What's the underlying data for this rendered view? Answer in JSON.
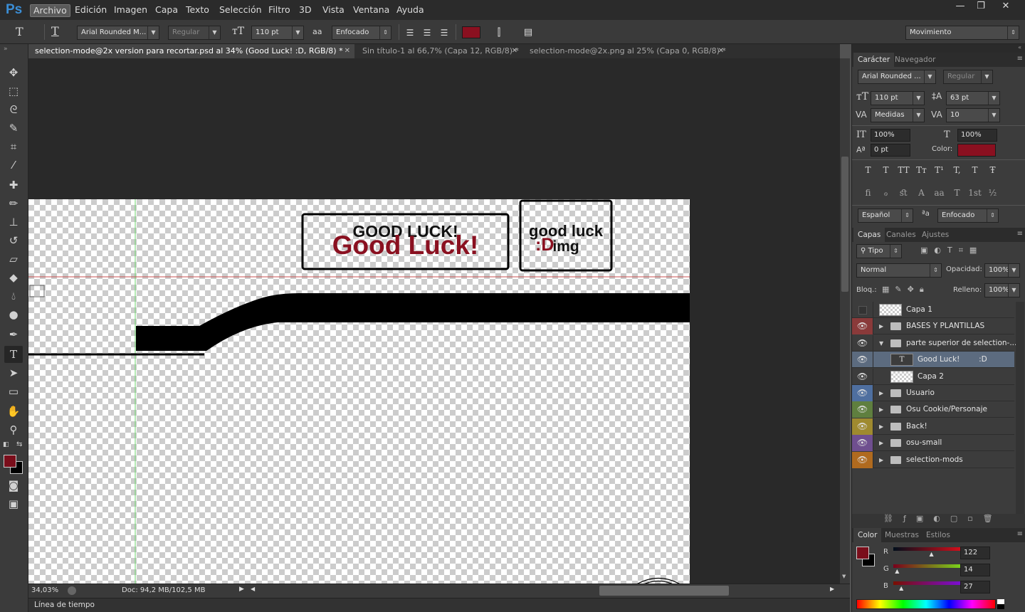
{
  "app": {
    "logo": "Ps"
  },
  "menu": [
    "Archivo",
    "Edición",
    "Imagen",
    "Capa",
    "Texto",
    "Selección",
    "Filtro",
    "3D",
    "Vista",
    "Ventana",
    "Ayuda"
  ],
  "window_controls": {
    "minimize": "—",
    "restore": "❐",
    "close": "✕"
  },
  "options": {
    "font_family": "Arial Rounded M...",
    "font_style": "Regular",
    "font_size": "110 pt",
    "antialias": "Enfocado",
    "color": "#8a1020",
    "workspace": "Movimiento",
    "aa_label": "aa"
  },
  "tabs": [
    {
      "label": "selection-mode@2x version para recortar.psd al 34% (Good Luck!         :D, RGB/8) *",
      "active": true
    },
    {
      "label": "Sin título-1 al 66,7% (Capa 12, RGB/8) *",
      "active": false
    },
    {
      "label": "selection-mode@2x.png al 25% (Capa 0, RGB/8) *",
      "active": false
    }
  ],
  "canvas": {
    "box1_upper": "GOOD LUCK!",
    "box1_lower": "Good Luck!",
    "box2_upper": "good luck",
    "box2_lower": "img",
    "box2_overlay": ":D",
    "accent_red": "#8a1020"
  },
  "status": {
    "zoom": "34,03%",
    "doc": "Doc: 94,2 MB/102,5 MB",
    "timeline": "Línea de tiempo"
  },
  "character_panel": {
    "tabs": [
      "Carácter",
      "Navegador"
    ],
    "font_family": "Arial Rounded ...",
    "font_style": "Regular",
    "size": "110 pt",
    "leading": "63 pt",
    "kerning": "Medidas",
    "tracking": "10",
    "vscale": "100%",
    "hscale": "100%",
    "baseline": "0 pt",
    "color_label": "Color:",
    "language": "Español",
    "antialias": "Enfocado",
    "glyphs_row1": [
      "T",
      "T",
      "TT",
      "Tт",
      "T¹",
      "T,",
      "T",
      "Ŧ"
    ],
    "glyphs_row2": [
      "ﬁ",
      "ℴ",
      "ﬆ",
      "A",
      "aa",
      "T",
      "1st",
      "½"
    ]
  },
  "layers_panel": {
    "tabs": [
      "Capas",
      "Canales",
      "Ajustes"
    ],
    "filter": "Tipo",
    "blend_mode": "Normal",
    "opacity_label": "Opacidad:",
    "opacity": "100%",
    "lock_label": "Bloq.:",
    "fill_label": "Relleno:",
    "fill": "100%",
    "layers": [
      {
        "name": "Capa 1",
        "type": "pixel",
        "visible": false,
        "color": "",
        "indent": 0
      },
      {
        "name": "BASES Y PLANTILLAS",
        "type": "group",
        "visible": true,
        "color": "#8a3a3a",
        "indent": 0,
        "open": false
      },
      {
        "name": "parte superior de selection-...",
        "type": "group",
        "visible": true,
        "color": "",
        "indent": 0,
        "open": true
      },
      {
        "name": "Good Luck!        :D",
        "type": "text",
        "visible": true,
        "color": "",
        "indent": 1,
        "selected": true
      },
      {
        "name": "Capa 2",
        "type": "pixel",
        "visible": true,
        "color": "",
        "indent": 1
      },
      {
        "name": "Usuario",
        "type": "group",
        "visible": true,
        "color": "#4f6f9f",
        "indent": 0,
        "open": false
      },
      {
        "name": "Osu Cookie/Personaje",
        "type": "group",
        "visible": true,
        "color": "#5f7f3f",
        "indent": 0,
        "open": false
      },
      {
        "name": "Back!",
        "type": "group",
        "visible": true,
        "color": "#9f8a2f",
        "indent": 0,
        "open": false
      },
      {
        "name": "osu-small",
        "type": "group",
        "visible": true,
        "color": "#6f4f8f",
        "indent": 0,
        "open": false
      },
      {
        "name": "selection-mods",
        "type": "group",
        "visible": true,
        "color": "#b06a1f",
        "indent": 0,
        "open": false
      }
    ]
  },
  "color_panel": {
    "tabs": [
      "Color",
      "Muestras",
      "Estilos"
    ],
    "r_label": "R",
    "g_label": "G",
    "b_label": "B",
    "r": 122,
    "g": 14,
    "b": 27,
    "fg": "#7a0e1b",
    "bg": "#000000"
  }
}
